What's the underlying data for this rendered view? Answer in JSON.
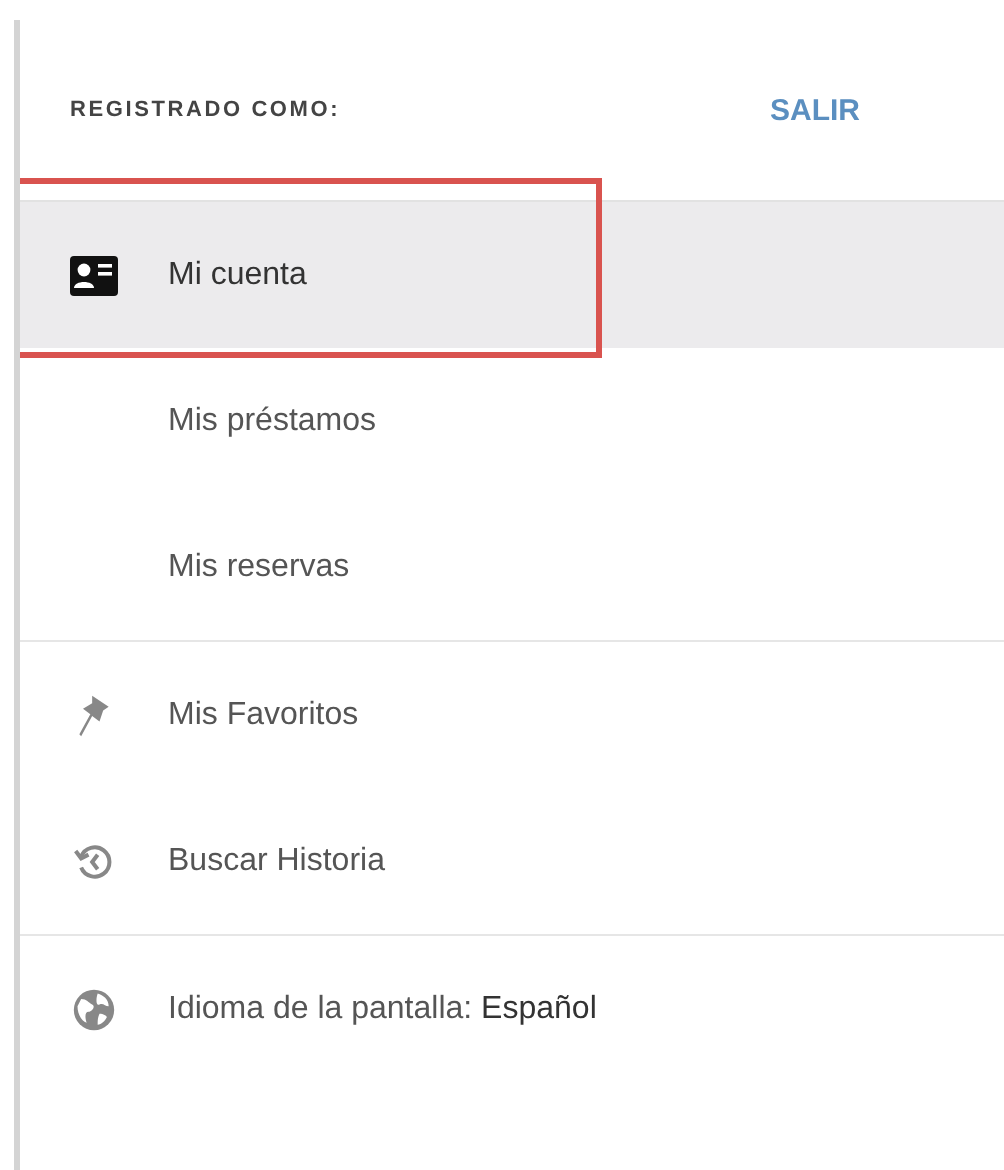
{
  "header": {
    "label": "REGISTRADO COMO:",
    "logout": "SALIR"
  },
  "sections": [
    {
      "items": [
        {
          "kind": "card",
          "label": "Mi cuenta",
          "selected": true,
          "outlined": true
        },
        {
          "kind": "sub",
          "label": "Mis préstamos",
          "selected": false,
          "outlined": false
        },
        {
          "kind": "sub",
          "label": "Mis reservas",
          "selected": false,
          "outlined": false
        }
      ]
    },
    {
      "items": [
        {
          "kind": "pin",
          "label": "Mis Favoritos",
          "selected": false,
          "outlined": false
        },
        {
          "kind": "history",
          "label": "Buscar Historia",
          "selected": false,
          "outlined": false
        }
      ]
    },
    {
      "items": [
        {
          "kind": "globe",
          "label": "Idioma de la pantalla: **Español**",
          "selected": false,
          "outlined": false
        }
      ]
    }
  ]
}
